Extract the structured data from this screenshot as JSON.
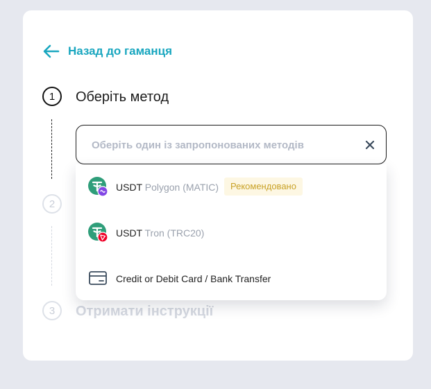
{
  "back_link": {
    "label": "Назад до гаманця"
  },
  "steps": [
    {
      "number": "1",
      "title": "Оберіть метод"
    },
    {
      "number": "2",
      "title": ""
    },
    {
      "number": "3",
      "title": "Отримати інструкції"
    }
  ],
  "method_select": {
    "placeholder": "Оберіть один із запропонованих методів",
    "options": [
      {
        "name": "USDT",
        "network": "Polygon (MATIC)",
        "badge": "Рекомендовано",
        "icon": "tether-polygon-icon"
      },
      {
        "name": "USDT",
        "network": "Tron (TRC20)",
        "icon": "tether-tron-icon"
      },
      {
        "name": "Credit or Debit Card / Bank Transfer",
        "icon": "credit-card-icon"
      }
    ]
  },
  "colors": {
    "accent": "#18a6bf",
    "tether": "#2f9e7a",
    "polygon": "#8247e5",
    "tron": "#ef0027",
    "badge_bg": "#fdf7e3",
    "badge_text": "#c9a227"
  }
}
